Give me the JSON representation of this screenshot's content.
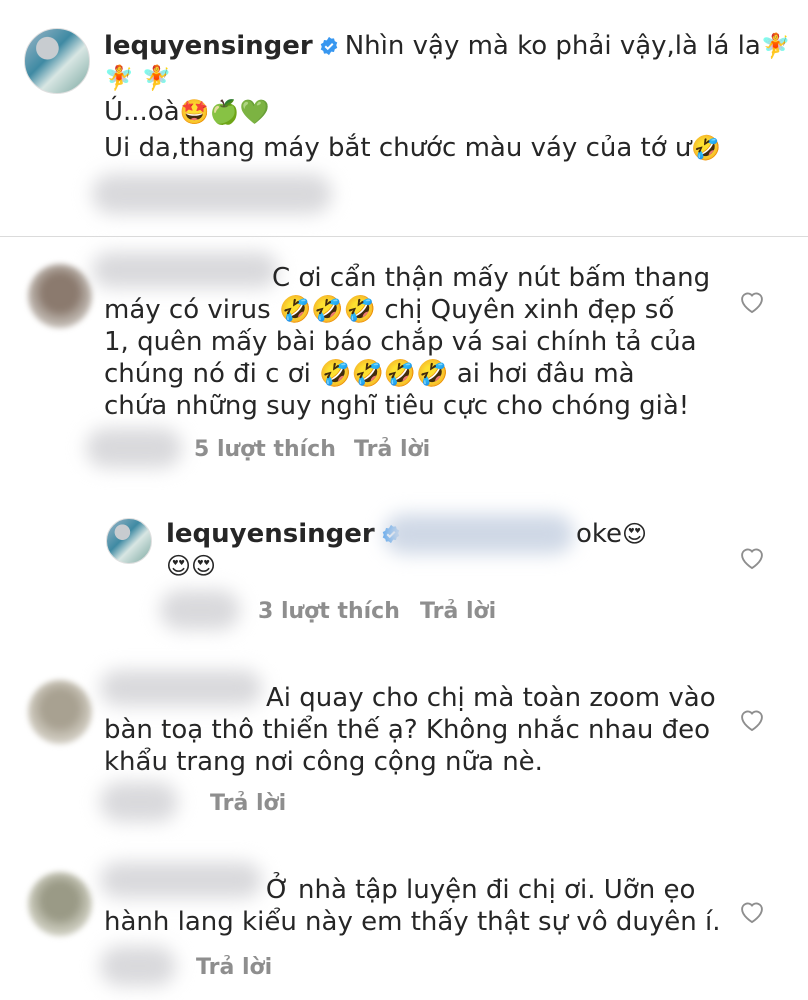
{
  "post": {
    "username": "lequyensinger",
    "line1": "Nhìn vậy mà ko phải vậy,là lá la",
    "line1_emoji": "🧚",
    "line2_emoji": "🧚 🧚",
    "line3": "Ú...oà",
    "line3_emoji": "🤩🍏💚",
    "line4": "Ui da,thang máy bắt chước màu váy của tớ ư",
    "line4_emoji": "🤣"
  },
  "comments": [
    {
      "lines": [
        "C ơi cẩn thận mấy nút bấm thang",
        "máy có virus 🤣🤣🤣 chị Quyên xinh đẹp số",
        "1, quên mấy bài báo chắp vá sai chính tả của",
        "chúng nó đi c ơi 🤣🤣🤣🤣 ai hơi đâu mà",
        "chứa những suy nghĩ tiêu cực cho chóng già!"
      ],
      "likes": "5 lượt thích",
      "reply": "Trả lời"
    },
    {
      "username": "lequyensinger",
      "text": "oke",
      "emoji1": "😍",
      "emoji2": "😍😍",
      "likes": "3 lượt thích",
      "reply": "Trả lời"
    },
    {
      "lines": [
        "Ai quay cho chị mà toàn zoom vào",
        "bàn toạ thô thiển thế ạ? Không nhắc nhau đeo",
        "khẩu trang nơi công cộng nữa nè."
      ],
      "reply": "Trả lời"
    },
    {
      "lines": [
        "Ở nhà tập luyện đi chị ơi. Uỡn ẹo",
        "hành lang kiểu này em thấy thật sự vô duyên í."
      ],
      "reply": "Trả lời"
    }
  ]
}
